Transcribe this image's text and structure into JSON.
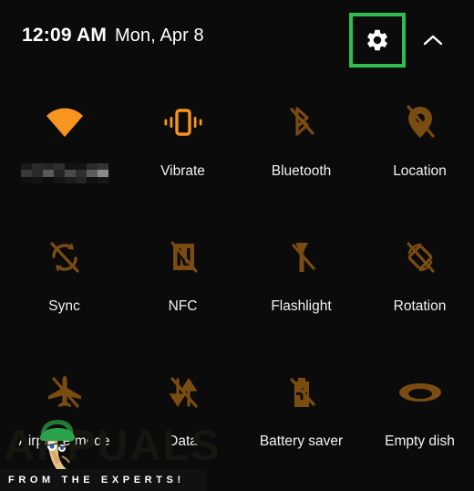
{
  "theme": {
    "background": "#0b0b0b",
    "accent_on": "#f79520",
    "accent_off": "#7a4c11",
    "label": "#f2f2f2",
    "highlight_border": "#2ebd4e"
  },
  "header": {
    "time": "12:09 AM",
    "date": "Mon, Apr 8",
    "settings_icon": "gear-icon",
    "collapse_icon": "chevron-up-icon",
    "settings_highlighted": true
  },
  "tiles": [
    [
      {
        "label": "",
        "label_redacted": true,
        "icon": "wifi-icon",
        "state": "on"
      },
      {
        "label": "Vibrate",
        "label_redacted": false,
        "icon": "vibrate-icon",
        "state": "on"
      },
      {
        "label": "Bluetooth",
        "label_redacted": false,
        "icon": "bluetooth-off-icon",
        "state": "off"
      },
      {
        "label": "Location",
        "label_redacted": false,
        "icon": "location-off-icon",
        "state": "off"
      }
    ],
    [
      {
        "label": "Sync",
        "label_redacted": false,
        "icon": "sync-off-icon",
        "state": "off"
      },
      {
        "label": "NFC",
        "label_redacted": false,
        "icon": "nfc-off-icon",
        "state": "off"
      },
      {
        "label": "Flashlight",
        "label_redacted": false,
        "icon": "flashlight-off-icon",
        "state": "off"
      },
      {
        "label": "Rotation",
        "label_redacted": false,
        "icon": "rotation-off-icon",
        "state": "off"
      }
    ],
    [
      {
        "label": "Airplane mode",
        "label_redacted": false,
        "icon": "airplane-off-icon",
        "state": "off"
      },
      {
        "label": "Data",
        "label_redacted": false,
        "icon": "data-off-icon",
        "state": "off"
      },
      {
        "label": "Battery saver",
        "label_redacted": false,
        "icon": "battery-saver-off-icon",
        "state": "off"
      },
      {
        "label": "Empty dish",
        "label_redacted": false,
        "icon": "dish-icon",
        "state": "off"
      }
    ]
  ],
  "watermark": {
    "word": "APPUALS",
    "tagline": "FROM THE EXPERTS!"
  }
}
